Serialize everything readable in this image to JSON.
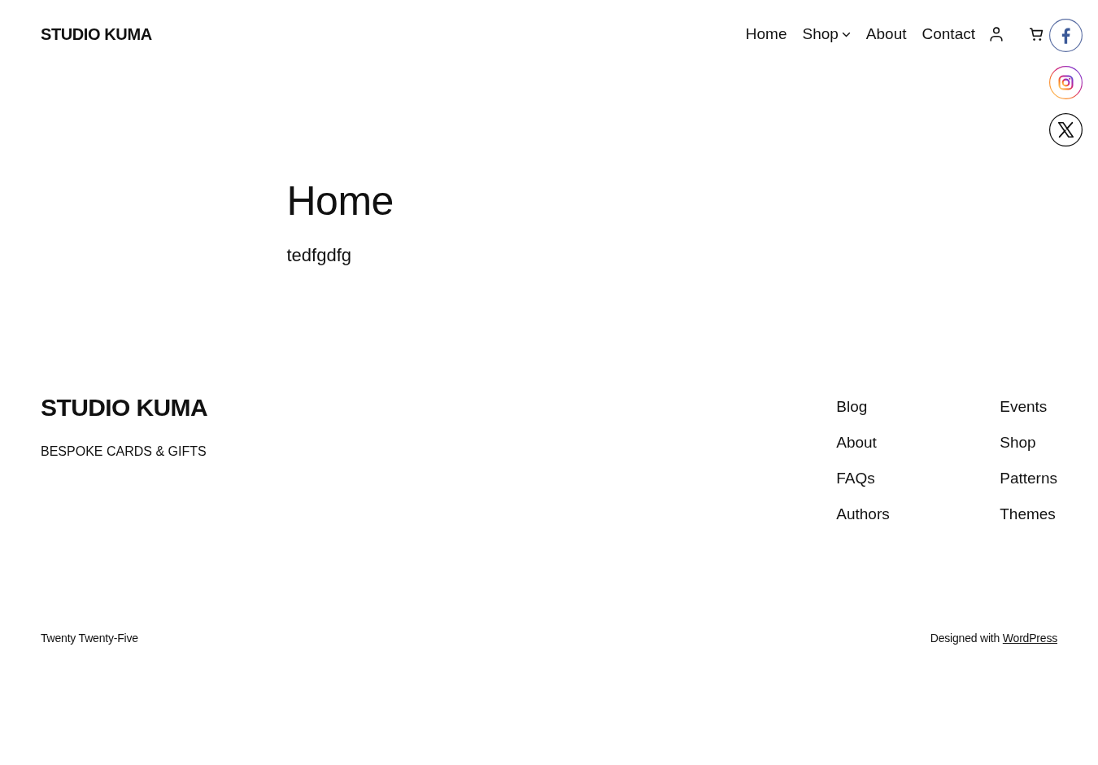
{
  "header": {
    "site_title": "STUDIO KUMA",
    "nav": [
      {
        "label": "Home",
        "kind": "link"
      },
      {
        "label": "Shop",
        "kind": "dropdown"
      },
      {
        "label": "About",
        "kind": "link"
      },
      {
        "label": "Contact",
        "kind": "link"
      }
    ]
  },
  "main": {
    "title": "Home",
    "text": "tedfgdfg"
  },
  "footer": {
    "site_title": "STUDIO KUMA",
    "tagline": "BESPOKE CARDS & GIFTS",
    "link_columns": [
      {
        "items": [
          "Blog",
          "About",
          "FAQs",
          "Authors"
        ]
      },
      {
        "items": [
          "Events",
          "Shop",
          "Patterns",
          "Themes"
        ]
      }
    ],
    "theme_credit": "Twenty Twenty-Five",
    "designed_with": {
      "text": "Designed with",
      "link": "WordPress"
    }
  }
}
